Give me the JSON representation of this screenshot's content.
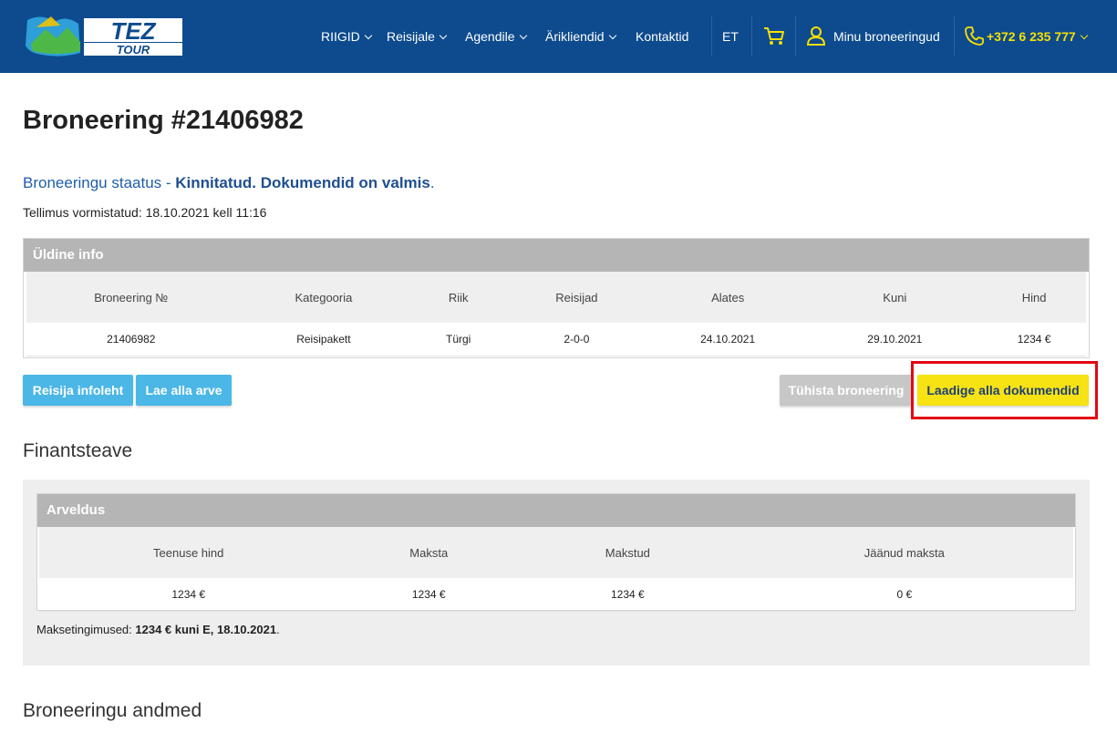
{
  "header": {
    "logo_text_top": "TEZ",
    "logo_text_bottom": "TOUR",
    "nav": [
      {
        "label": "RIIGID"
      },
      {
        "label": "Reisijale"
      },
      {
        "label": "Agendile"
      },
      {
        "label": "Ärikliendid"
      },
      {
        "label": "Kontaktid"
      }
    ],
    "language": "ET",
    "my_bookings": "Minu broneeringud",
    "phone": "+372 6 235 777"
  },
  "booking": {
    "title": "Broneering #21406982",
    "status_prefix": "Broneeringu staatus - ",
    "status_value": "Kinnitatud. Dokumendid on valmis",
    "status_suffix": ".",
    "ordered": "Tellimus vormistatud: 18.10.2021 kell 11:16"
  },
  "general_info": {
    "heading": "Üldine info",
    "columns": [
      "Broneering №",
      "Kategooria",
      "Riik",
      "Reisijad",
      "Alates",
      "Kuni",
      "Hind"
    ],
    "row": [
      "21406982",
      "Reisipakett",
      "Türgi",
      "2-0-0",
      "24.10.2021",
      "29.10.2021",
      "1234 €"
    ]
  },
  "actions": {
    "traveler_info": "Reisija infoleht",
    "download_invoice": "Lae alla arve",
    "cancel_booking": "Tühista broneering",
    "download_documents": "Laadige alla dokumendid"
  },
  "finance": {
    "title": "Finantsteave",
    "billing_heading": "Arveldus",
    "columns": [
      "Teenuse hind",
      "Maksta",
      "Makstud",
      "Jäänud maksta"
    ],
    "row": [
      "1234 €",
      "1234 €",
      "1234 €",
      "0 €"
    ],
    "terms_label": "Maksetingimused: ",
    "terms_value": "1234 € kuni E, 18.10.2021",
    "terms_suffix": "."
  },
  "booking_details_title": "Broneeringu andmed",
  "colors": {
    "header_bg": "#0d4b8e",
    "accent_yellow": "#f7e214",
    "button_blue": "#4bb7e6",
    "highlight_red": "#e30613"
  }
}
